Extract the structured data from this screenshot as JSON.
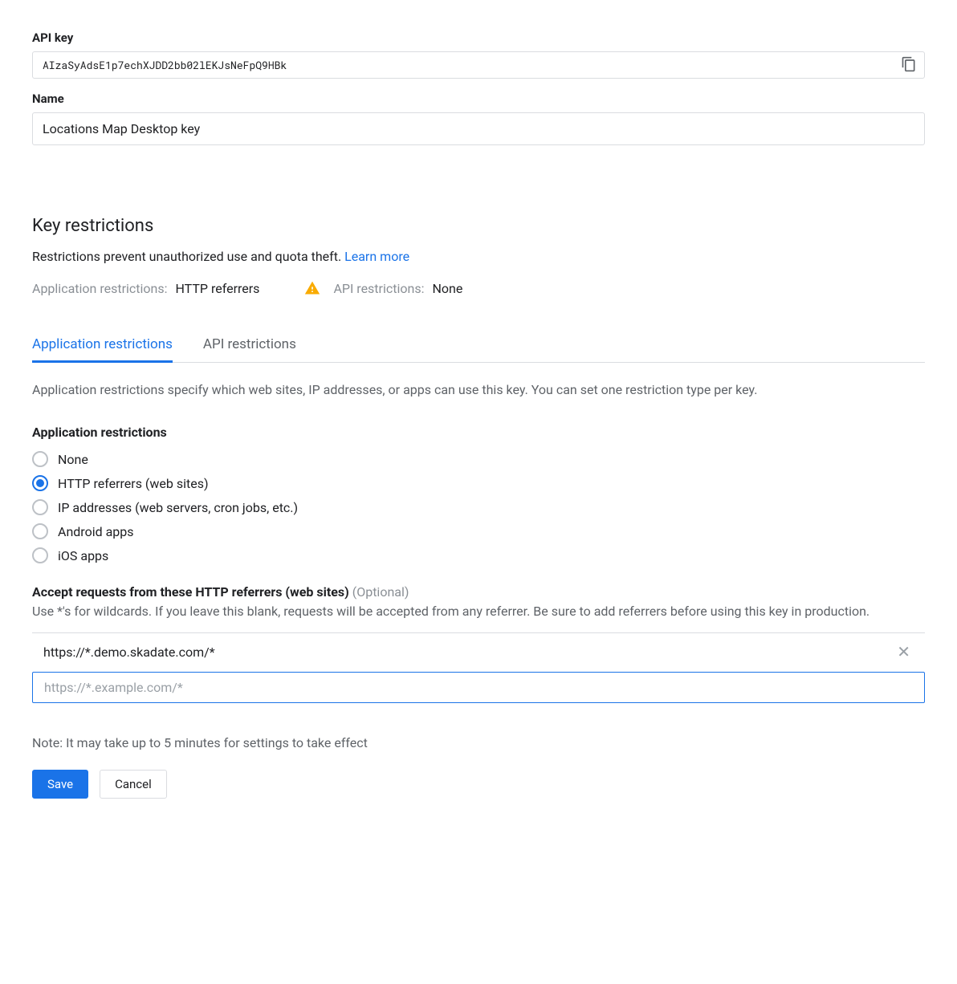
{
  "apiKey": {
    "label": "API key",
    "value": "AIzaSyAdsE1p7echXJDD2bb02lEKJsNeFpQ9HBk"
  },
  "name": {
    "label": "Name",
    "value": "Locations Map Desktop key"
  },
  "restrictions": {
    "heading": "Key restrictions",
    "desc": "Restrictions prevent unauthorized use and quota theft. ",
    "learnMore": "Learn more",
    "appLabel": "Application restrictions:",
    "appValue": "HTTP referrers",
    "apiLabel": "API restrictions:",
    "apiValue": "None"
  },
  "tabs": {
    "app": "Application restrictions",
    "api": "API restrictions"
  },
  "appTab": {
    "desc": "Application restrictions specify which web sites, IP addresses, or apps can use this key. You can set one restriction type per key.",
    "groupTitle": "Application restrictions",
    "options": {
      "none": "None",
      "http": "HTTP referrers (web sites)",
      "ip": "IP addresses (web servers, cron jobs, etc.)",
      "android": "Android apps",
      "ios": "iOS apps"
    },
    "selected": "http"
  },
  "referrers": {
    "heading": "Accept requests from these HTTP referrers (web sites)",
    "optional": "(Optional)",
    "help": "Use *'s for wildcards. If you leave this blank, requests will be accepted from any referrer. Be sure to add referrers before using this key in production.",
    "entries": [
      "https://*.demo.skadate.com/*"
    ],
    "placeholder": "https://*.example.com/*"
  },
  "note": "Note: It may take up to 5 minutes for settings to take effect",
  "buttons": {
    "save": "Save",
    "cancel": "Cancel"
  }
}
